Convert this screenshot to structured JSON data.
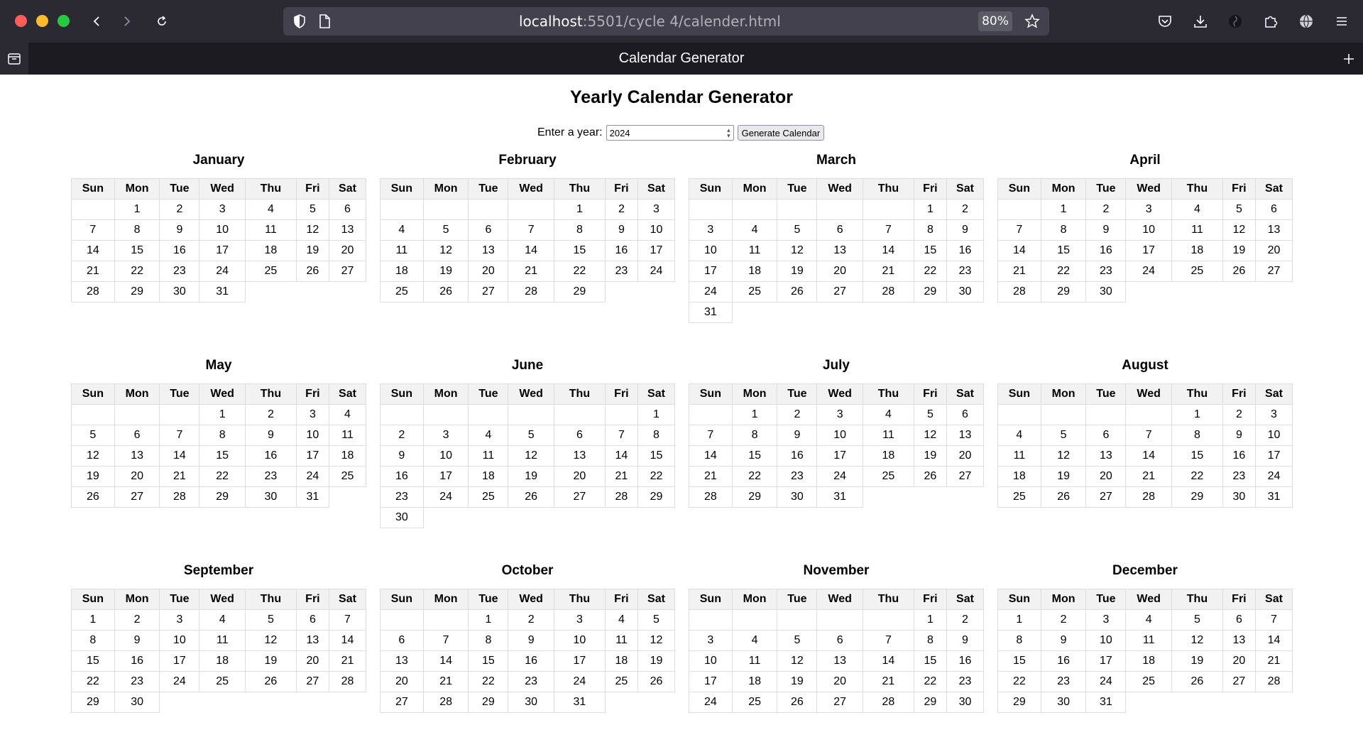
{
  "browser": {
    "url_host": "localhost",
    "url_rest": ":5501/cycle 4/calender.html",
    "zoom": "80%",
    "tab_title": "Calendar Generator"
  },
  "page": {
    "heading": "Yearly Calendar Generator",
    "year_label": "Enter a year:",
    "year_value": "2024",
    "generate_label": "Generate Calendar"
  },
  "weekdays": [
    "Sun",
    "Mon",
    "Tue",
    "Wed",
    "Thu",
    "Fri",
    "Sat"
  ],
  "months": [
    {
      "name": "January",
      "start": 1,
      "days": 31
    },
    {
      "name": "February",
      "start": 4,
      "days": 29
    },
    {
      "name": "March",
      "start": 5,
      "days": 31
    },
    {
      "name": "April",
      "start": 1,
      "days": 30
    },
    {
      "name": "May",
      "start": 3,
      "days": 31
    },
    {
      "name": "June",
      "start": 6,
      "days": 30
    },
    {
      "name": "July",
      "start": 1,
      "days": 31
    },
    {
      "name": "August",
      "start": 4,
      "days": 31
    },
    {
      "name": "September",
      "start": 0,
      "days": 30
    },
    {
      "name": "October",
      "start": 2,
      "days": 31
    },
    {
      "name": "November",
      "start": 5,
      "days": 30
    },
    {
      "name": "December",
      "start": 0,
      "days": 31
    }
  ]
}
